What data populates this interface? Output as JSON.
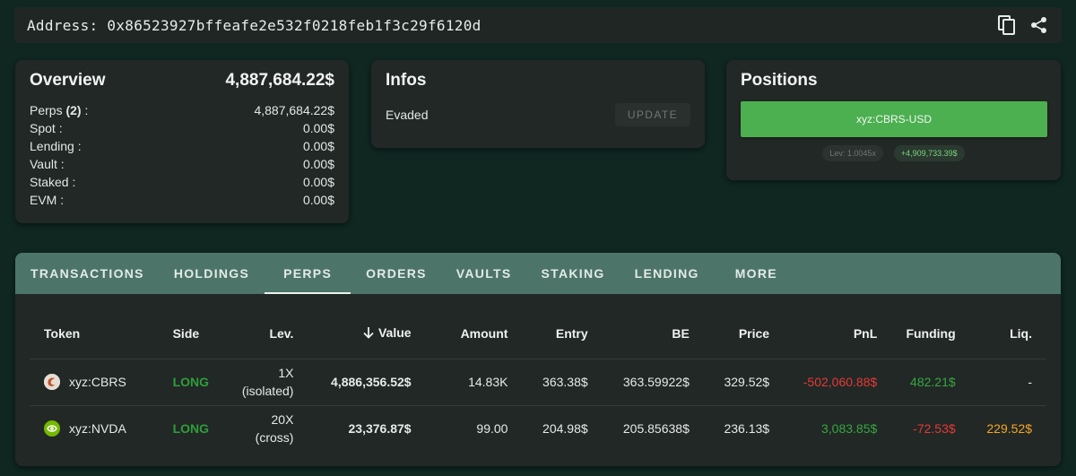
{
  "address": {
    "label": "Address: 0x86523927bffeafe2e532f0218feb1f3c29f6120d"
  },
  "overview": {
    "title": "Overview",
    "total": "4,887,684.22$",
    "rows": [
      {
        "label": "Perps ",
        "count": "(2)",
        "suffix": " :",
        "value": "4,887,684.22$"
      },
      {
        "label": "Spot :",
        "value": "0.00$"
      },
      {
        "label": "Lending :",
        "value": "0.00$"
      },
      {
        "label": "Vault :",
        "value": "0.00$"
      },
      {
        "label": "Staked :",
        "value": "0.00$"
      },
      {
        "label": "EVM :",
        "value": "0.00$"
      }
    ]
  },
  "infos": {
    "title": "Infos",
    "status": "Evaded",
    "update_label": "UPDATE"
  },
  "positions": {
    "title": "Positions",
    "button_label": "xyz:CBRS-USD",
    "lev_chip": "Lev: 1.0045x",
    "pnl_chip": "+4,909,733.39$"
  },
  "tabs": [
    "TRANSACTIONS",
    "HOLDINGS",
    "PERPS",
    "ORDERS",
    "VAULTS",
    "STAKING",
    "LENDING",
    "MORE"
  ],
  "table": {
    "headers": {
      "token": "Token",
      "side": "Side",
      "lev": "Lev.",
      "value": "Value",
      "amount": "Amount",
      "entry": "Entry",
      "be": "BE",
      "price": "Price",
      "pnl": "PnL",
      "funding": "Funding",
      "liq": "Liq."
    },
    "rows": [
      {
        "token": "xyz:CBRS",
        "icon": "cbrs-token-icon",
        "side": "LONG",
        "lev": "1X",
        "lev_mode": "(isolated)",
        "value": "4,886,356.52$",
        "amount": "14.83K",
        "entry": "363.38$",
        "be": "363.59922$",
        "price": "329.52$",
        "pnl": "-502,060.88$",
        "funding": "482.21$",
        "liq": "-"
      },
      {
        "token": "xyz:NVDA",
        "icon": "nvda-token-icon",
        "side": "LONG",
        "lev": "20X",
        "lev_mode": "(cross)",
        "value": "23,376.87$",
        "amount": "99.00",
        "entry": "204.98$",
        "be": "205.85638$",
        "price": "236.13$",
        "pnl": "3,083.85$",
        "funding": "-72.53$",
        "liq": "229.52$"
      }
    ]
  },
  "colors": {
    "background": "#0f2621",
    "card": "#222826",
    "tabbar": "#4d7468",
    "positive": "#36a63f",
    "negative": "#e53935",
    "warning": "#f5a623",
    "position_button": "#4caf50"
  }
}
